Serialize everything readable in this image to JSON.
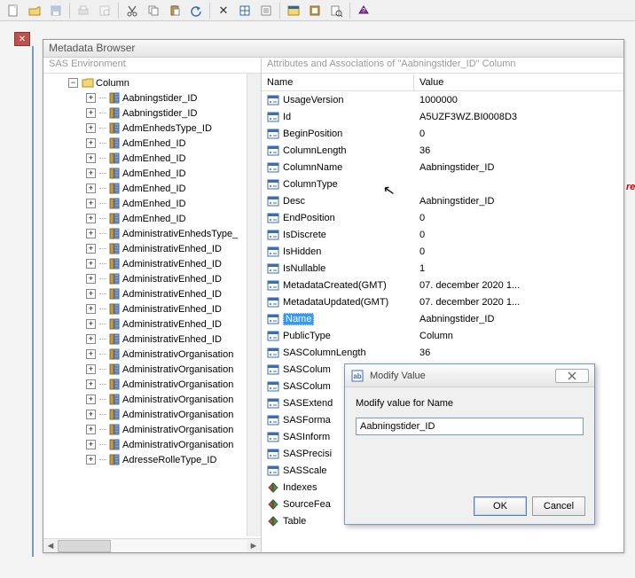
{
  "window_title": "Metadata Browser",
  "tree": {
    "header": "SAS Environment",
    "root_label": "Column",
    "items": [
      "Aabningstider_ID",
      "Aabningstider_ID",
      "AdmEnhedsType_ID",
      "AdmEnhed_ID",
      "AdmEnhed_ID",
      "AdmEnhed_ID",
      "AdmEnhed_ID",
      "AdmEnhed_ID",
      "AdmEnhed_ID",
      "AdministrativEnhedsType_",
      "AdministrativEnhed_ID",
      "AdministrativEnhed_ID",
      "AdministrativEnhed_ID",
      "AdministrativEnhed_ID",
      "AdministrativEnhed_ID",
      "AdministrativEnhed_ID",
      "AdministrativEnhed_ID",
      "AdministrativOrganisation",
      "AdministrativOrganisation",
      "AdministrativOrganisation",
      "AdministrativOrganisation",
      "AdministrativOrganisation",
      "AdministrativOrganisation",
      "AdministrativOrganisation",
      "AdresseRolleType_ID"
    ]
  },
  "attributes": {
    "header": "Attributes and Associations of \"Aabningstider_ID\" Column",
    "col_name": "Name",
    "col_value": "Value",
    "rows": [
      {
        "name": "UsageVersion",
        "value": "1000000",
        "icon": "prop"
      },
      {
        "name": "Id",
        "value": "A5UZF3WZ.BI0008D3",
        "icon": "prop"
      },
      {
        "name": "BeginPosition",
        "value": "0",
        "icon": "prop"
      },
      {
        "name": "ColumnLength",
        "value": "36",
        "icon": "prop"
      },
      {
        "name": "ColumnName",
        "value": "Aabningstider_ID",
        "icon": "prop"
      },
      {
        "name": "ColumnType",
        "value": "",
        "icon": "prop"
      },
      {
        "name": "Desc",
        "value": "Aabningstider_ID",
        "icon": "prop"
      },
      {
        "name": "EndPosition",
        "value": "0",
        "icon": "prop"
      },
      {
        "name": "IsDiscrete",
        "value": "0",
        "icon": "prop"
      },
      {
        "name": "IsHidden",
        "value": "0",
        "icon": "prop"
      },
      {
        "name": "IsNullable",
        "value": "1",
        "icon": "prop"
      },
      {
        "name": "MetadataCreated(GMT)",
        "value": "07. december 2020 1...",
        "icon": "prop"
      },
      {
        "name": "MetadataUpdated(GMT)",
        "value": "07. december 2020 1...",
        "icon": "prop"
      },
      {
        "name": "Name",
        "value": "Aabningstider_ID",
        "icon": "prop",
        "selected": true
      },
      {
        "name": "PublicType",
        "value": "Column",
        "icon": "prop"
      },
      {
        "name": "SASColumnLength",
        "value": "36",
        "icon": "prop"
      },
      {
        "name": "SASColum",
        "value": "",
        "icon": "prop"
      },
      {
        "name": "SASColum",
        "value": "",
        "icon": "prop"
      },
      {
        "name": "SASExtend",
        "value": "",
        "icon": "prop"
      },
      {
        "name": "SASForma",
        "value": "",
        "icon": "prop"
      },
      {
        "name": "SASInform",
        "value": "",
        "icon": "prop"
      },
      {
        "name": "SASPrecisi",
        "value": "",
        "icon": "prop"
      },
      {
        "name": "SASScale",
        "value": "",
        "icon": "prop"
      },
      {
        "name": "Indexes",
        "value": "",
        "icon": "link"
      },
      {
        "name": "SourceFea",
        "value": "",
        "icon": "link"
      },
      {
        "name": "Table",
        "value": "",
        "icon": "link"
      }
    ]
  },
  "modify_dialog": {
    "title": "Modify Value",
    "label": "Modify value for Name",
    "input_value": "Aabningstider_ID",
    "ok": "OK",
    "cancel": "Cancel"
  }
}
